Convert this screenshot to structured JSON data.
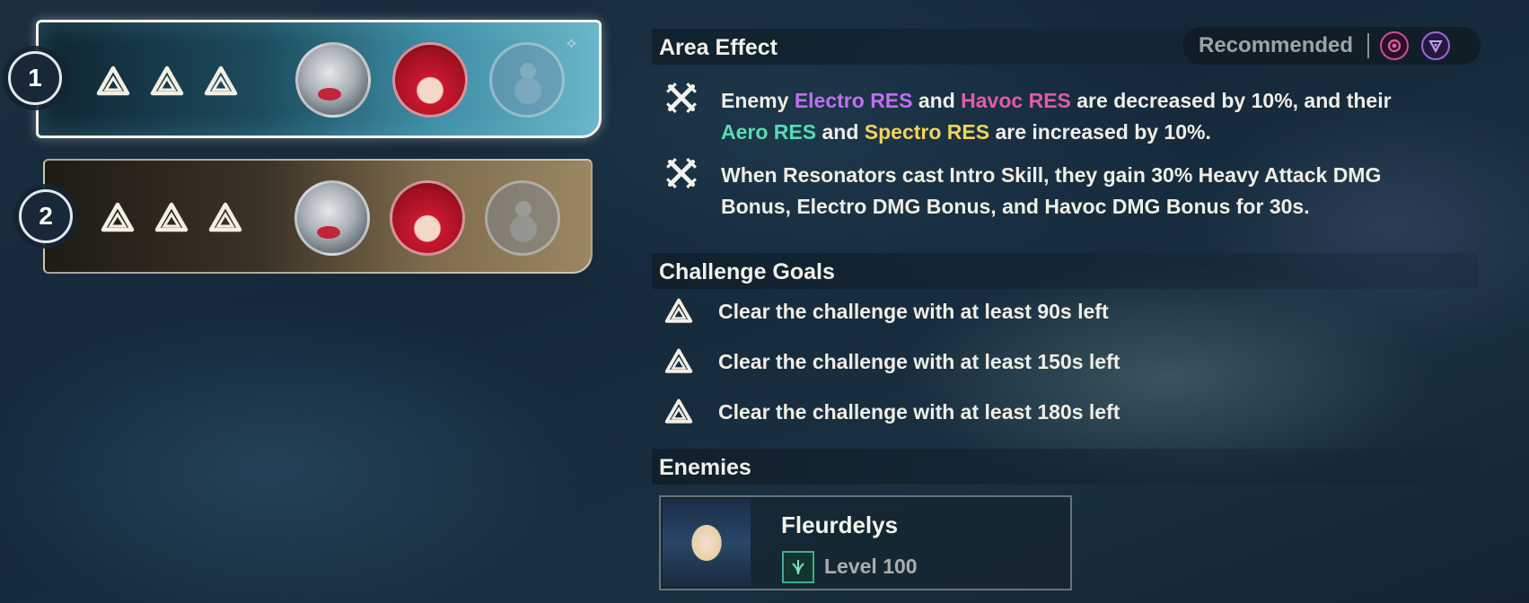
{
  "teams": [
    {
      "number": "1",
      "stars": 3
    },
    {
      "number": "2",
      "stars": 3
    }
  ],
  "area_effect": {
    "title": "Area Effect",
    "recommended_label": "Recommended",
    "effect1_parts": {
      "p1": "Enemy ",
      "electro": "Electro RES",
      "p2": " and ",
      "havoc": "Havoc RES",
      "p3": " are decreased by 10%, and their",
      "aero": "Aero RES",
      "p4": " and ",
      "spectro": "Spectro RES",
      "p5": " are increased by 10%."
    },
    "effect2": "When Resonators cast Intro Skill, they gain 30% Heavy Attack DMG Bonus, Electro DMG Bonus, and Havoc DMG Bonus for 30s."
  },
  "challenge_goals": {
    "title": "Challenge Goals",
    "items": [
      "Clear the challenge with at least 90s left",
      "Clear the challenge with at least 150s left",
      "Clear the challenge with at least 180s left"
    ]
  },
  "enemies": {
    "title": "Enemies",
    "list": [
      {
        "name": "Fleurdelys",
        "level": "Level 100"
      }
    ]
  },
  "colors": {
    "electro": "#c06ff0",
    "havoc": "#e55aa6",
    "aero": "#56dcb2",
    "spectro": "#f2d35c"
  }
}
